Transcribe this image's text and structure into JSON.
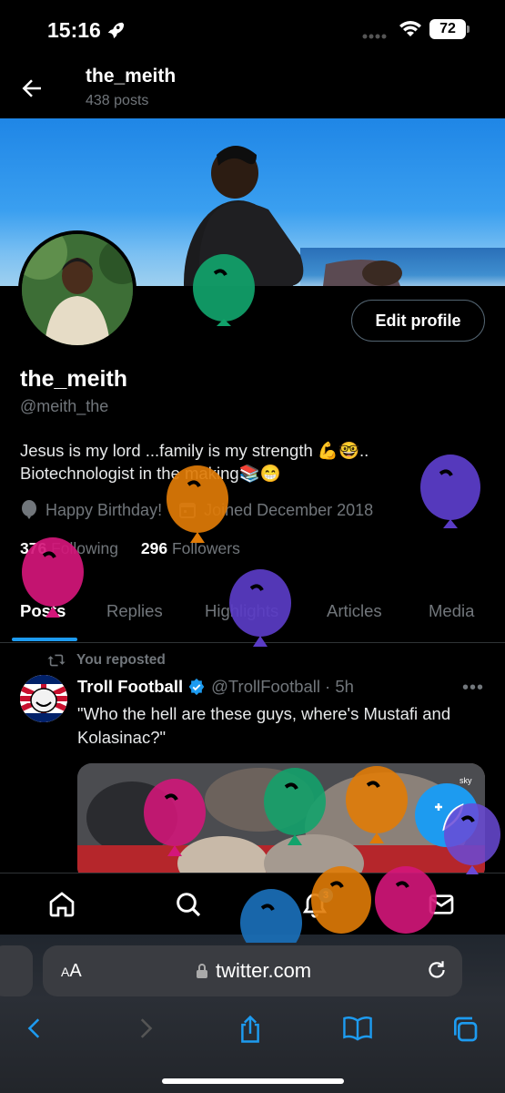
{
  "status_bar": {
    "time": "15:16",
    "battery": "72"
  },
  "header": {
    "name": "the_meith",
    "posts_count": "438 posts"
  },
  "profile": {
    "edit_button": "Edit profile",
    "display_name": "the_meith",
    "handle": "@meith_the",
    "bio_line1": "Jesus is my lord ...family is my strength 💪🤓..",
    "bio_line2": "Biotechnologist in the making📚😁",
    "birthday": "Happy Birthday!",
    "joined": "Joined December 2018",
    "following_count": "376",
    "following_label": "Following",
    "followers_count": "296",
    "followers_label": "Followers"
  },
  "tabs": [
    {
      "label": "Posts",
      "active": true
    },
    {
      "label": "Replies",
      "active": false
    },
    {
      "label": "Highlights",
      "active": false
    },
    {
      "label": "Articles",
      "active": false
    },
    {
      "label": "Media",
      "active": false
    }
  ],
  "tweet": {
    "reposted_label": "You reposted",
    "author_name": "Troll Football",
    "author_handle": "@TrollFootball",
    "time": "· 5h",
    "text": "\"Who the hell are these guys, where's Mustafi and Kolasinac?\"",
    "more": "•••"
  },
  "bottom_nav": {
    "items": [
      "home-icon",
      "search-icon",
      "notifications-icon",
      "messages-icon"
    ],
    "notification_count": "3"
  },
  "browser": {
    "text_size_label": "AA",
    "domain": "twitter.com",
    "toolbar": [
      "back-icon",
      "forward-icon",
      "share-icon",
      "bookmarks-icon",
      "tabs-icon"
    ]
  },
  "colors": {
    "accent": "#1d9bf0",
    "muted": "#71767b",
    "balloon_green": "#11a36b",
    "balloon_orange": "#e07b07",
    "balloon_purple": "#5a3cc6",
    "balloon_magenta": "#d4167a"
  }
}
